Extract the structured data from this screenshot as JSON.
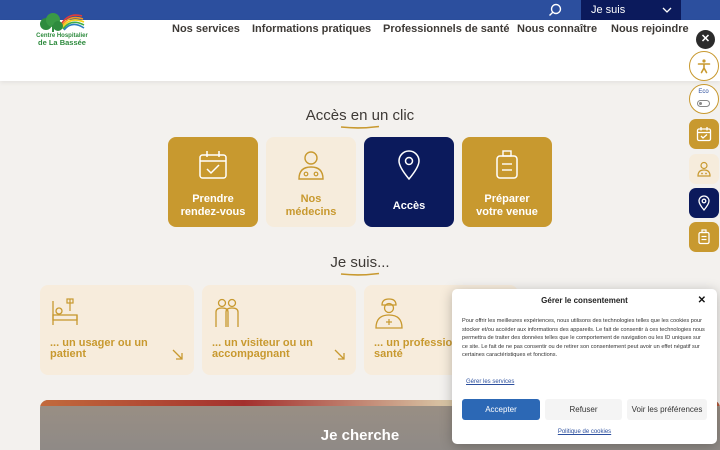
{
  "topbar": {
    "jesuis_label": "Je suis"
  },
  "logo": {
    "line1": "Centre Hospitalier",
    "line2": "de La Bassée"
  },
  "nav": [
    "Nos services",
    "Informations pratiques",
    "Professionnels de santé",
    "Nous connaître",
    "Nous rejoindre"
  ],
  "side": {
    "eco_label": "Eco"
  },
  "acces": {
    "title": "Accès en un clic",
    "cards": [
      {
        "line1": "Prendre",
        "line2": "rendez-vous",
        "icon": "calendar-check-icon"
      },
      {
        "line1": "Nos",
        "line2": "médecins",
        "icon": "doctor-icon"
      },
      {
        "line1": "Accès",
        "line2": "",
        "icon": "location-pin-icon"
      },
      {
        "line1": "Préparer",
        "line2": "votre venue",
        "icon": "suitcase-icon"
      }
    ]
  },
  "jesuis": {
    "title": "Je suis...",
    "cards": [
      {
        "line1": "... un usager ou un",
        "line2": "patient",
        "icon": "hospital-bed-icon"
      },
      {
        "line1": "... un visiteur ou un",
        "line2": "accompagnant",
        "icon": "visitors-icon"
      },
      {
        "line1": "... un professionnel de",
        "line2": "santé",
        "icon": "nurse-icon"
      }
    ]
  },
  "banner": {
    "title": "Je cherche"
  },
  "consent": {
    "title": "Gérer le consentement",
    "text": "Pour offrir les meilleures expériences, nous utilisons des technologies telles que les cookies pour stocker et/ou accéder aux informations des appareils. Le fait de consentir à ces technologies nous permettra de traiter des données telles que le comportement de navigation ou les ID uniques sur ce site. Le fait de ne pas consentir ou de retirer son consentement peut avoir un effet négatif sur certaines caractéristiques et fonctions.",
    "manage_link": "Gérer les services",
    "accept": "Accepter",
    "refuse": "Refuser",
    "prefs": "Voir les préférences",
    "policy": "Politique de cookies"
  },
  "colors": {
    "gold": "#c8992f",
    "navy": "#0b1a5c",
    "blue": "#2c4f9e",
    "cream": "#f6ecdc"
  }
}
